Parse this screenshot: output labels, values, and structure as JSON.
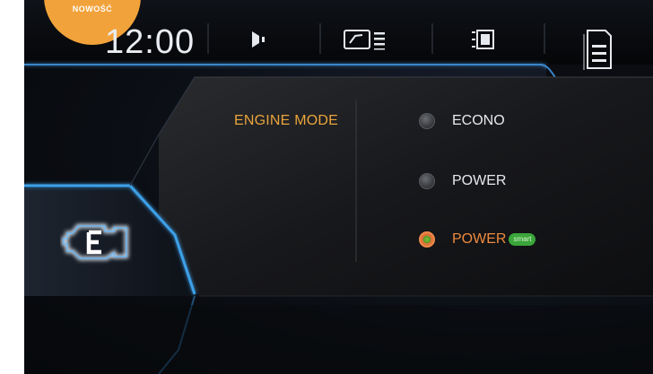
{
  "badge": {
    "text": "NOWOŚĆ"
  },
  "status_bar": {
    "time": "12:00",
    "icons": [
      "audio-icon",
      "gauge-list-icon",
      "screen-icon",
      "document-menu-icon"
    ]
  },
  "engine_mode": {
    "title": "ENGINE MODE",
    "options": [
      {
        "label": "ECONO",
        "selected": false
      },
      {
        "label": "POWER",
        "selected": false
      },
      {
        "label": "POWER",
        "tag": "smart",
        "selected": true
      }
    ]
  },
  "colors": {
    "accent_orange": "#e9a43c",
    "selected_orange": "#ef8a3e",
    "smart_green": "#3aa63a",
    "frame_blue": "#3ea0e8",
    "badge_orange": "#f2a23a"
  }
}
